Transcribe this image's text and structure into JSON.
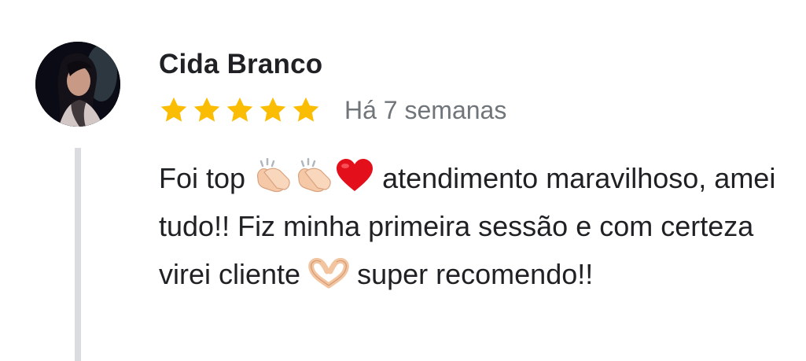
{
  "review": {
    "author_name": "Cida Branco",
    "rating": 5,
    "rating_max": 5,
    "date": "Há 7 semanas",
    "text": {
      "part1": "Foi top ",
      "part2": " atendimento maravilhoso, amei tudo!! Fiz minha primeira sessão e com certeza virei cliente ",
      "part3": " super recomendo!!"
    },
    "emojis": [
      "clapping-hands-icon",
      "clapping-hands-icon",
      "red-heart-icon",
      "heart-hands-icon"
    ]
  },
  "colors": {
    "star": "#fbbc04",
    "date": "#70757a",
    "quote_bar": "#dadce0",
    "text": "#202124"
  }
}
